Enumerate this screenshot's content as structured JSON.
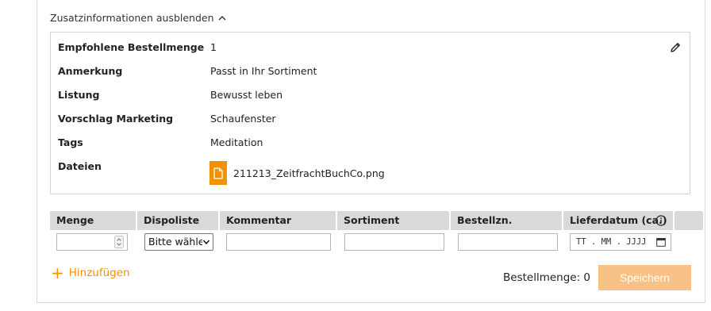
{
  "toggle_label": "Zusatzinformationen ausblenden",
  "info": {
    "rows": [
      {
        "label": "Empfohlene Bestellmenge",
        "value": "1"
      },
      {
        "label": "Anmerkung",
        "value": "Passt in Ihr Sortiment"
      },
      {
        "label": "Listung",
        "value": "Bewusst leben"
      },
      {
        "label": "Vorschlag Marketing",
        "value": "Schaufenster"
      },
      {
        "label": "Tags",
        "value": "Meditation"
      },
      {
        "label": "Dateien",
        "value": ""
      }
    ],
    "file_name": "211213_ZeitfrachtBuchCo.png"
  },
  "table": {
    "headers": [
      "Menge",
      "Dispoliste",
      "Kommentar",
      "Sortiment",
      "Bestellzn.",
      "Lieferdatum (ca.)"
    ],
    "dispoliste_value": "Bitte wählen",
    "date_placeholder": "TT . MM . JJJJ"
  },
  "add_label": "Hinzufügen",
  "total_label": "Bestellmenge: 0",
  "save_label": "Speichern",
  "colors": {
    "accent": "#f39200",
    "save_disabled": "#f8c185",
    "header_bg": "#d9d9d9"
  },
  "icons": [
    "chevron-up-icon",
    "pencil-icon",
    "file-icon",
    "info-icon",
    "spinner-icon",
    "calendar-icon",
    "plus-icon"
  ]
}
